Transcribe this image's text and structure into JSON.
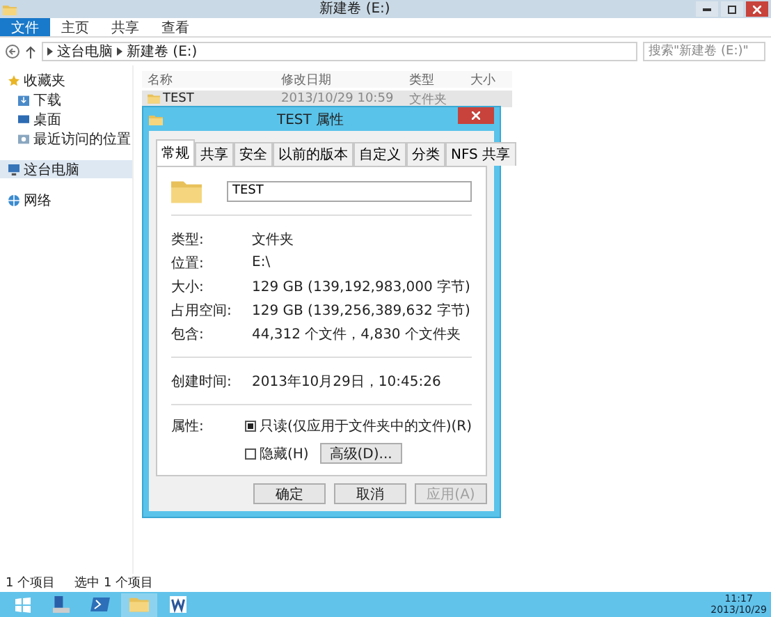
{
  "window": {
    "title": "新建卷 (E:)"
  },
  "ribbon_tabs": [
    {
      "label": "文件",
      "selected": true
    },
    {
      "label": "主页",
      "selected": false
    },
    {
      "label": "共享",
      "selected": false
    },
    {
      "label": "查看",
      "selected": false
    }
  ],
  "address": {
    "path": [
      "这台电脑",
      "新建卷 (E:)"
    ],
    "search_placeholder": "搜索\"新建卷 (E:)\""
  },
  "sidebar": {
    "groups": [
      {
        "label": "收藏夹",
        "selected": false,
        "children": [
          {
            "label": "下载",
            "selected": false
          },
          {
            "label": "桌面",
            "selected": false
          },
          {
            "label": "最近访问的位置",
            "selected": false
          }
        ]
      },
      {
        "label": "这台电脑",
        "selected": true
      },
      {
        "label": "网络",
        "selected": false
      }
    ]
  },
  "table": {
    "columns": [
      "名称",
      "修改日期",
      "类型",
      "大小"
    ],
    "rows": [
      {
        "name": "TEST",
        "modified": "2013/10/29 10:59",
        "type": "文件夹",
        "selected": true
      }
    ]
  },
  "dialog": {
    "title": "TEST 属性",
    "tabs": [
      {
        "label": "常规",
        "selected": true
      },
      {
        "label": "共享",
        "selected": false
      },
      {
        "label": "安全",
        "selected": false
      },
      {
        "label": "以前的版本",
        "selected": false
      },
      {
        "label": "自定义",
        "selected": false
      },
      {
        "label": "分类",
        "selected": false
      },
      {
        "label": "NFS 共享",
        "selected": false
      }
    ],
    "name": "TEST",
    "info": [
      {
        "label": "类型:",
        "value": "文件夹"
      },
      {
        "label": "位置:",
        "value": "E:\\"
      },
      {
        "label": "大小:",
        "value": "129 GB (139,192,983,000 字节)"
      },
      {
        "label": "占用空间:",
        "value": "129 GB (139,256,389,632 字节)"
      },
      {
        "label": "包含:",
        "value": "44,312 个文件，4,830 个文件夹"
      }
    ],
    "created": {
      "label": "创建时间:",
      "value": "2013年10月29日，10:45:26"
    },
    "attributes_label": "属性:",
    "attributes": [
      {
        "label": "只读(仅应用于文件夹中的文件)(R)",
        "kind": "mixed",
        "checked": true
      },
      {
        "label": "隐藏(H)",
        "kind": "box",
        "checked": false
      }
    ],
    "advanced_button": "高级(D)...",
    "buttons": [
      {
        "label": "确定",
        "disabled": false
      },
      {
        "label": "取消",
        "disabled": false
      },
      {
        "label": "应用(A)",
        "disabled": true
      }
    ]
  },
  "status_bar": [
    "1 个项目",
    "选中 1 个项目"
  ],
  "taskbar": {
    "apps": [
      {
        "selected": false
      },
      {
        "selected": false
      },
      {
        "selected": false
      },
      {
        "selected": true
      },
      {
        "selected": false
      }
    ],
    "time": "11:17",
    "date": "2013/10/29"
  }
}
